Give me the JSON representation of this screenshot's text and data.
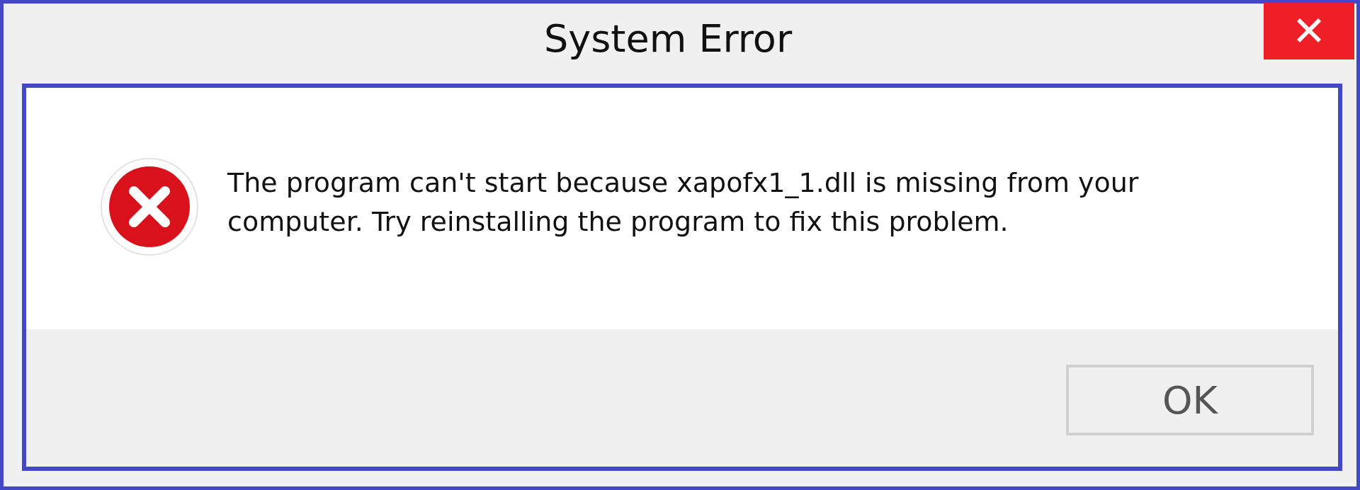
{
  "window": {
    "title": "System Error",
    "close_label": "✕"
  },
  "message": "The program can't start because xapofx1_1.dll is missing from your computer. Try reinstalling the program to fix this problem.",
  "buttons": [
    "OK"
  ]
}
